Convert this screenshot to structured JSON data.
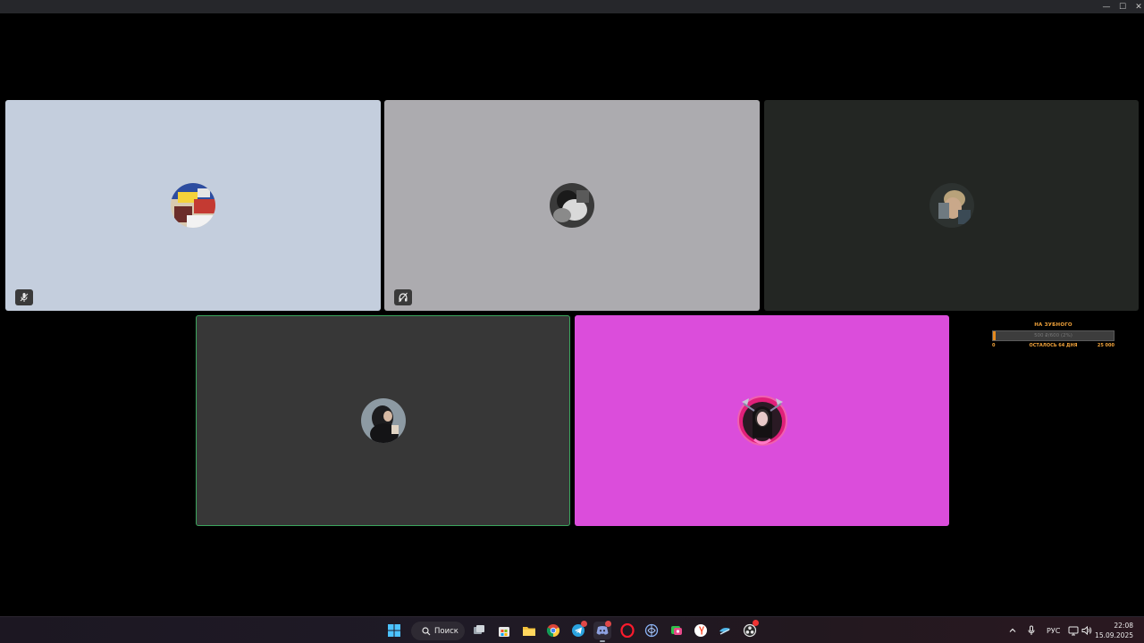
{
  "window": {
    "minimize_glyph": "—",
    "maximize_glyph": "☐",
    "close_glyph": "✕"
  },
  "participants": [
    {
      "id": "p1",
      "bg": "#c4cedd",
      "status_icon": "mic-icon",
      "avatar_icon": "avatar-image"
    },
    {
      "id": "p2",
      "bg": "#acabaf",
      "status_icon": "muted-headphones-icon",
      "avatar_icon": "avatar-image"
    },
    {
      "id": "p3",
      "bg": "#232623",
      "status_icon": "",
      "avatar_icon": "avatar-image"
    },
    {
      "id": "p4",
      "bg": "#373737",
      "status_icon": "",
      "avatar_icon": "avatar-image",
      "speaking": true,
      "speaking_color": "#3ba55d"
    },
    {
      "id": "p5",
      "bg": "#db4ddb",
      "status_icon": "",
      "avatar_icon": "avatar-image"
    }
  ],
  "goal": {
    "title": "НА ЗУБНОГО",
    "bar_text": "500 ₽/600 (2%)",
    "progress": 0.02,
    "min": "0",
    "remaining": "ОСТАЛОСЬ 64 ДНЯ",
    "max": "25 000",
    "accent": "#e58a1f"
  },
  "taskbar": {
    "search_label": "Поиск",
    "apps": [
      "windows-start-icon",
      "task-view-icon",
      "microsoft-store-icon",
      "file-explorer-icon",
      "chrome-icon",
      "telegram-icon",
      "discord-icon",
      "opera-icon",
      "ai-app-icon",
      "messenger-icon",
      "yandex-browser-icon",
      "steam-icon",
      "obs-icon"
    ],
    "language": "РУС",
    "time": "22:08",
    "date": "15.09.2025"
  }
}
